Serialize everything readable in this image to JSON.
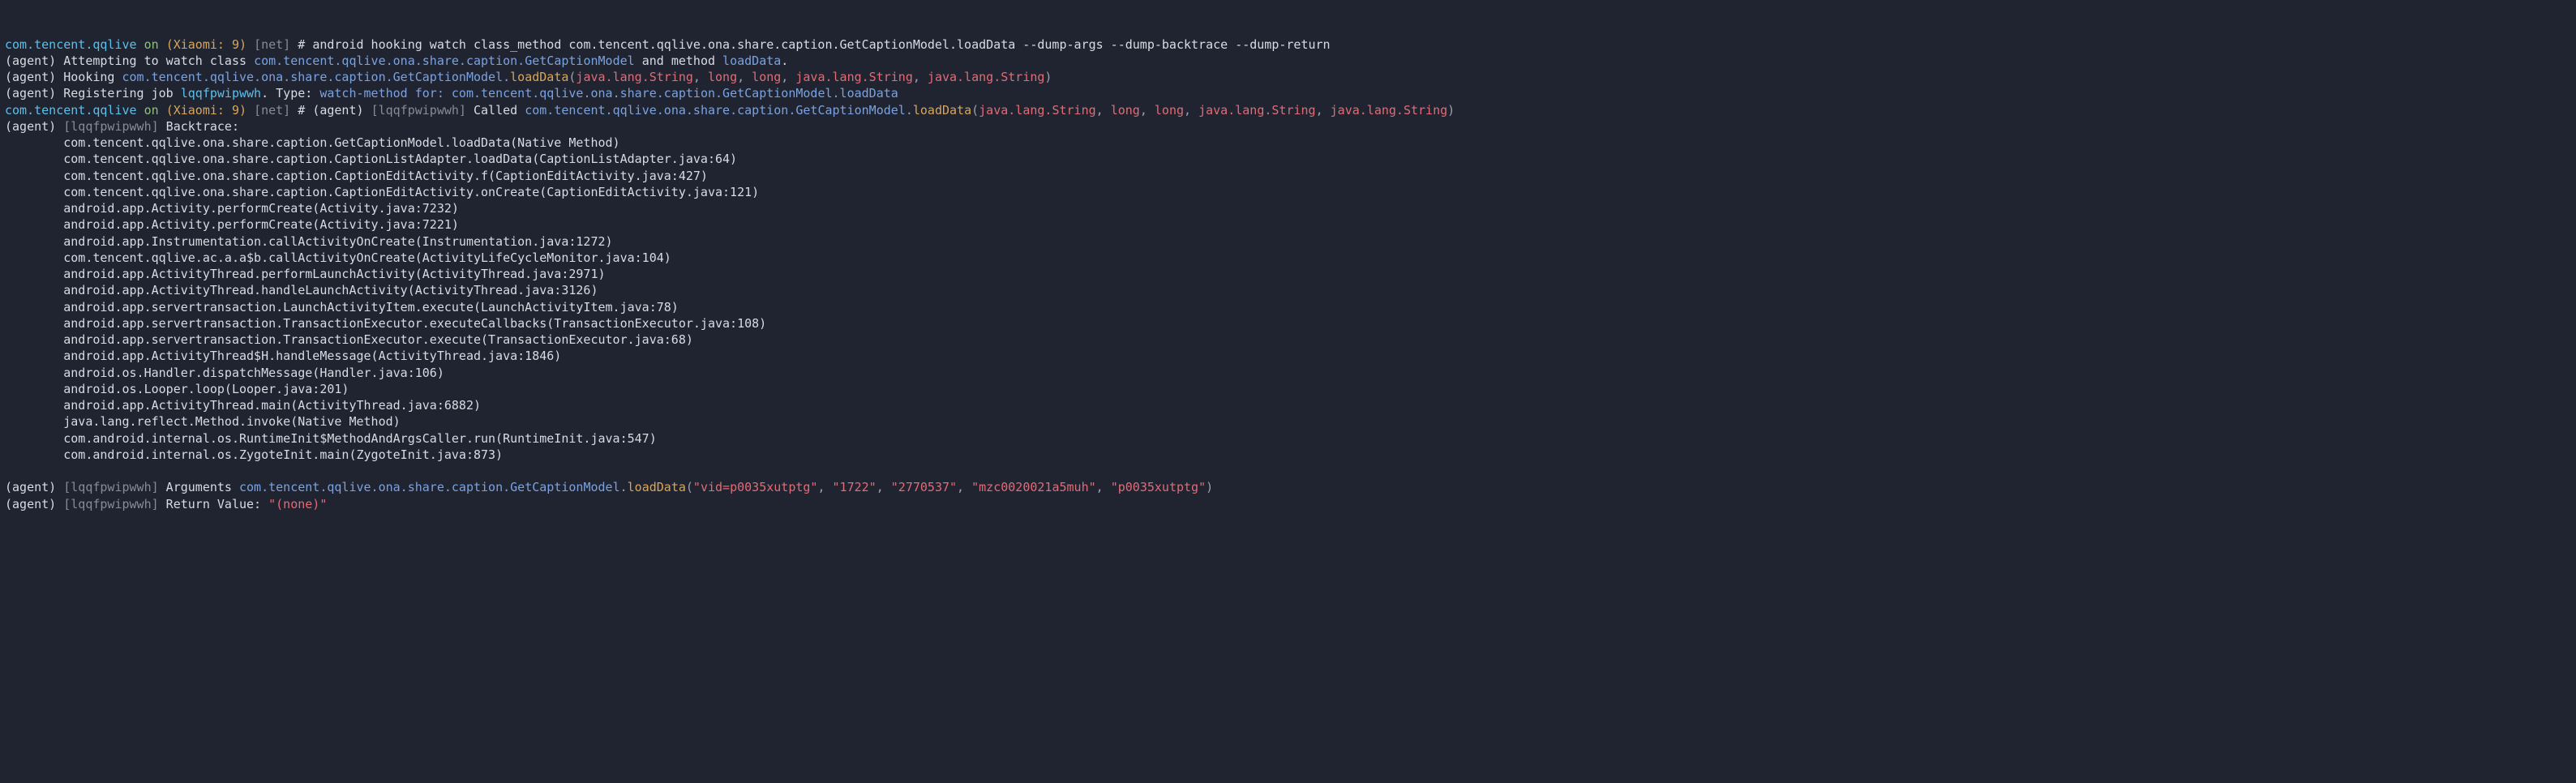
{
  "prompt1": {
    "app": "com.tencent.qqlive",
    "on": "on",
    "device": "(Xiaomi: 9)",
    "scope": "[net]",
    "hash": "#",
    "command": "android hooking watch class_method com.tencent.qqlive.ona.share.caption.GetCaptionModel.loadData --dump-args --dump-backtrace --dump-return"
  },
  "line2": {
    "prefix": "(agent) ",
    "t1": "Attempting to watch class ",
    "cls": "com.tencent.qqlive.ona.share.caption.GetCaptionModel",
    "t2": " and method ",
    "method": "loadData",
    "dot": "."
  },
  "line3": {
    "prefix": "(agent) ",
    "t1": "Hooking ",
    "cls": "com.tencent.qqlive.ona.share.caption.GetCaptionModel",
    "dot1": ".",
    "method": "loadData",
    "open": "(",
    "a0": "java.lang.String",
    "c": ", ",
    "a1": "long",
    "a2": "long",
    "a3": "java.lang.String",
    "a4": "java.lang.String",
    "close": ")"
  },
  "line4": {
    "prefix": "(agent) ",
    "t1": "Registering job ",
    "job": "lqqfpwipwwh",
    "t2": ". Type: ",
    "type": "watch-method",
    "for": " for: ",
    "target": "com.tencent.qqlive.ona.share.caption.GetCaptionModel.loadData"
  },
  "prompt2": {
    "app": "com.tencent.qqlive",
    "on": "on",
    "device": "(Xiaomi: 9)",
    "scope": "[net]",
    "hash": "#",
    "agent": "(agent) ",
    "jobtag": "[lqqfpwipwwh]",
    "called": " Called ",
    "cls": "com.tencent.qqlive.ona.share.caption.GetCaptionModel",
    "dot1": ".",
    "method": "loadData",
    "open": "(",
    "a0": "java.lang.String",
    "c": ", ",
    "a1": "long",
    "a2": "long",
    "a3": "java.lang.String",
    "a4": "java.lang.String",
    "close": ")"
  },
  "bthead": {
    "prefix": "(agent) ",
    "jobtag": "[lqqfpwipwwh]",
    "label": " Backtrace:"
  },
  "bt": {
    "l0": "        com.tencent.qqlive.ona.share.caption.GetCaptionModel.loadData(Native Method)",
    "l1": "        com.tencent.qqlive.ona.share.caption.CaptionListAdapter.loadData(CaptionListAdapter.java:64)",
    "l2": "        com.tencent.qqlive.ona.share.caption.CaptionEditActivity.f(CaptionEditActivity.java:427)",
    "l3": "        com.tencent.qqlive.ona.share.caption.CaptionEditActivity.onCreate(CaptionEditActivity.java:121)",
    "l4": "        android.app.Activity.performCreate(Activity.java:7232)",
    "l5": "        android.app.Activity.performCreate(Activity.java:7221)",
    "l6": "        android.app.Instrumentation.callActivityOnCreate(Instrumentation.java:1272)",
    "l7": "        com.tencent.qqlive.ac.a.a$b.callActivityOnCreate(ActivityLifeCycleMonitor.java:104)",
    "l8": "        android.app.ActivityThread.performLaunchActivity(ActivityThread.java:2971)",
    "l9": "        android.app.ActivityThread.handleLaunchActivity(ActivityThread.java:3126)",
    "l10": "        android.app.servertransaction.LaunchActivityItem.execute(LaunchActivityItem.java:78)",
    "l11": "        android.app.servertransaction.TransactionExecutor.executeCallbacks(TransactionExecutor.java:108)",
    "l12": "        android.app.servertransaction.TransactionExecutor.execute(TransactionExecutor.java:68)",
    "l13": "        android.app.ActivityThread$H.handleMessage(ActivityThread.java:1846)",
    "l14": "        android.os.Handler.dispatchMessage(Handler.java:106)",
    "l15": "        android.os.Looper.loop(Looper.java:201)",
    "l16": "        android.app.ActivityThread.main(ActivityThread.java:6882)",
    "l17": "        java.lang.reflect.Method.invoke(Native Method)",
    "l18": "        com.android.internal.os.RuntimeInit$MethodAndArgsCaller.run(RuntimeInit.java:547)",
    "l19": "        com.android.internal.os.ZygoteInit.main(ZygoteInit.java:873)"
  },
  "args": {
    "prefix": "(agent) ",
    "jobtag": "[lqqfpwipwwh]",
    "label": " Arguments ",
    "cls": "com.tencent.qqlive.ona.share.caption.GetCaptionModel",
    "dot1": ".",
    "method": "loadData",
    "open": "(",
    "v0": "\"vid=p0035xutptg\"",
    "c": ", ",
    "v1": "\"1722\"",
    "v2": "\"2770537\"",
    "v3": "\"mzc0020021a5muh\"",
    "v4": "\"p0035xutptg\"",
    "close": ")"
  },
  "ret": {
    "prefix": "(agent) ",
    "jobtag": "[lqqfpwipwwh]",
    "label": " Return Value: ",
    "value": "\"(none)\""
  },
  "blank": ""
}
